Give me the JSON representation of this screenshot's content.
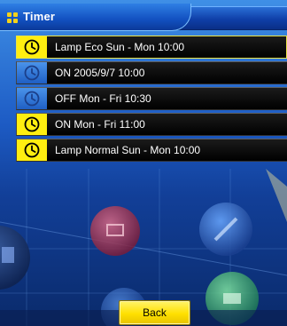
{
  "window": {
    "title": "Timer",
    "icon": "grid-icon",
    "accent_color": "#ffee10"
  },
  "timers": [
    {
      "label": "Lamp Eco Sun - Mon 10:00",
      "icon": "clock-icon",
      "enabled": true,
      "selected": true
    },
    {
      "label": "ON 2005/9/7 10:00",
      "icon": "clock-icon",
      "enabled": false,
      "selected": false
    },
    {
      "label": "OFF Mon - Fri 10:30",
      "icon": "clock-icon",
      "enabled": false,
      "selected": false
    },
    {
      "label": "ON Mon - Fri 11:00",
      "icon": "clock-icon",
      "enabled": true,
      "selected": false
    },
    {
      "label": "Lamp Normal Sun - Mon 10:00",
      "icon": "clock-icon",
      "enabled": true,
      "selected": false
    }
  ],
  "footer": {
    "back_label": "Back"
  }
}
